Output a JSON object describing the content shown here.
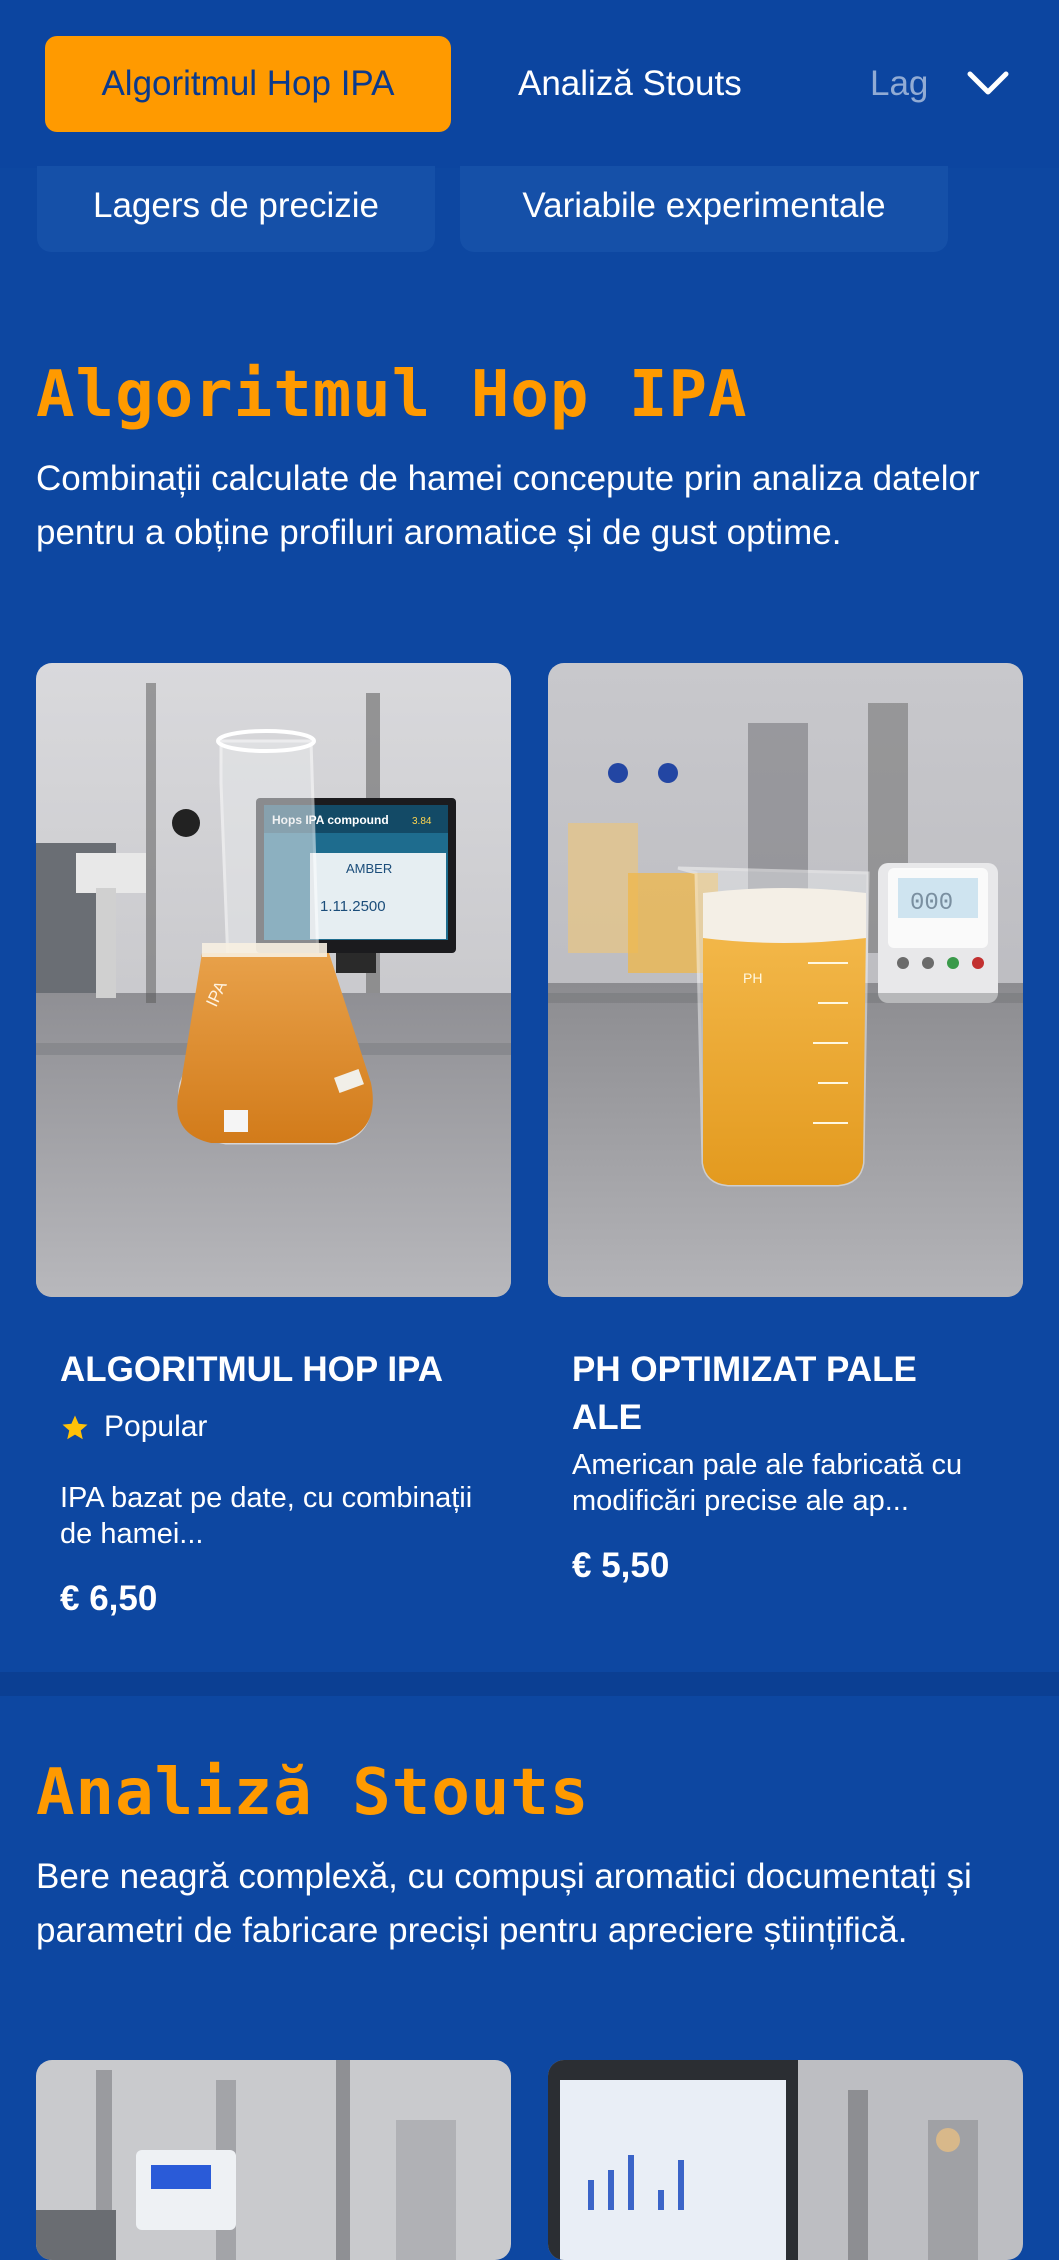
{
  "nav": {
    "tabs": [
      {
        "label": "Algoritmul Hop IPA",
        "active": true
      },
      {
        "label": "Analiză Stouts",
        "active": false
      },
      {
        "label": "Lag",
        "active": false
      }
    ],
    "expand_icon": "chevron-down-icon",
    "chips": [
      "Lagers de precizie",
      "Variabile experimentale"
    ]
  },
  "sections": [
    {
      "title": "Algoritmul Hop IPA",
      "description": "Combinații calculate de hamei concepute prin analiza datelor pentru a obține profiluri aromatice și de gust optime.",
      "products": [
        {
          "name": "ALGORITMUL HOP IPA",
          "badge": "Popular",
          "badge_icon": "star-icon",
          "description": "IPA bazat pe date, cu combinații de hamei...",
          "price": "€ 6,50"
        },
        {
          "name": "PH OPTIMIZAT PALE ALE",
          "description": "American pale ale fabricată cu modificări precise ale ap...",
          "price": "€ 5,50"
        }
      ]
    },
    {
      "title": "Analiză Stouts",
      "description": "Bere neagră complexă, cu compuși aromatici documentați și parametri de fabricare preciși pentru apreciere științifică."
    }
  ],
  "image_texts": {
    "monitor_title": "Hops IPA compound",
    "monitor_value": "3.84",
    "monitor_label": "AMBER",
    "monitor_reading": "1.11.2500",
    "flask_label": "IPA",
    "beaker_label": "PH",
    "meter_display": "000"
  },
  "colors": {
    "background": "#0d47a1",
    "accent": "#ff9a00",
    "star": "#ffc107"
  }
}
